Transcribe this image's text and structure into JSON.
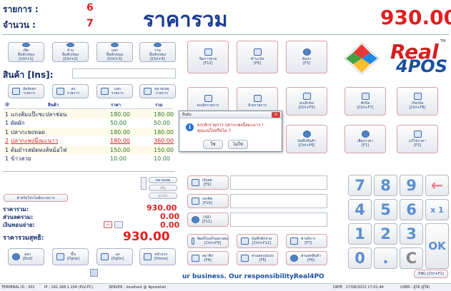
{
  "summary": {
    "items_label": "รายการ :",
    "items_value": "6",
    "qty_label": "จำนวน :",
    "qty_value": "7",
    "title": "ราคารวม",
    "total": "930.00"
  },
  "logo": {
    "real": "Real",
    "fourpos": "4POS",
    "tm": "TM"
  },
  "top_buttons": [
    {
      "label": "เปิด\nลิ้นชัก/ห่อง\n[Ctrl+1]"
    },
    {
      "label": "ย้าย\nลิ้นชัก/ห่อง\n[Ctrl+2]"
    },
    {
      "label": "แยก\nลิ้นชัก/ห่อง\n[Ctrl+3]"
    },
    {
      "label": "รวม\nลิ้นชัก/ห่อง\n[Ctrl+4]"
    }
  ],
  "product_label": "สินค้า [Ins]:",
  "edit_buttons": [
    {
      "label": "ลัดจัดส่ง\nรายการ"
    },
    {
      "label": "ลบ\nรายการ"
    },
    {
      "label": "แยก\nรายการ"
    },
    {
      "label": "หมายเหตุ\nรายการ"
    }
  ],
  "table": {
    "headers": [
      "@",
      "สินค้า",
      "ราคา",
      "รวม"
    ],
    "rows": [
      {
        "qty": "1",
        "name": "แกงส้มแป๊ะซะปลาช่อน",
        "price": "180.00",
        "total": "180.00",
        "style": "normal"
      },
      {
        "qty": "1",
        "name": "ผัดผัก",
        "price": "50.00",
        "total": "50.00",
        "style": "normal"
      },
      {
        "qty": "1",
        "name": "ปลากะพงทอด",
        "price": "180.00",
        "total": "180.00",
        "style": "normal"
      },
      {
        "qty": "2",
        "name": "ปลากะพงนึ่งมะนาว",
        "price": "180.00",
        "total": "360.00",
        "style": "red"
      },
      {
        "qty": "1",
        "name": "ต้มยำรสมัดหงส์หม้อไฟ",
        "price": "150.00",
        "total": "150.00",
        "style": "normal"
      },
      {
        "qty": "1",
        "name": "ข้าวสวย",
        "price": "10.00",
        "total": "10.00",
        "style": "normal"
      }
    ]
  },
  "side_small": {
    "note": "หมายเหตุ",
    "add": "เพิ่ม",
    "cancel": "ยกเลิก"
  },
  "promo_button": "สำหรับโปรโมชั่นรายการ",
  "totals": {
    "price_label": "ราคารวม:",
    "price": "930.00",
    "discount_label": "ส่วนลดรวม:",
    "discount": "0.00",
    "change_label": "เงินทอนจ่าย:",
    "change": "0.00",
    "net_label": "ราคารวมสุทธิ:",
    "net": "930.00"
  },
  "bottom_buttons": [
    {
      "label": "ออก\n[End]"
    },
    {
      "label": "ขึ้น\n[PgUp]"
    },
    {
      "label": "ลง\n[PgDn]"
    },
    {
      "label": "หน้าแรก\n[Home]"
    }
  ],
  "mid_buttons": [
    {
      "label": "ปิดการขาย\n[F12]"
    },
    {
      "label": "ชำระเงิน\n[F8]"
    },
    {
      "label": "ค้นหา\n[F3]"
    },
    {
      "label": "ยกเลิกรายการ"
    },
    {
      "label": "ย้ายรายการ"
    },
    {
      "label": "ยกเลิกบิล\n[Ctrl+F5]"
    },
    {
      "label": "พักบิล\n[Ctrl+F7]"
    },
    {
      "label": "เรียกบิล\n[Ctrl+F8]"
    },
    {
      "label": "บันทึกสินค้า\n[Ctrl+F6]"
    },
    {
      "label": "เลือกราคา\n[F1]"
    },
    {
      "label": "แก้ไขราคา\n[F2]"
    }
  ],
  "pay_buttons": [
    {
      "label": "เงินสด\n[F9]"
    },
    {
      "label": "เครดิต\n[F10]"
    },
    {
      "label": "USD\n[F11]"
    }
  ],
  "bottom_mid": [
    {
      "label": "พิมพ์ใบเสร็จอย่างย่อ\n[Ctrl+F9]"
    },
    {
      "label": "บันทึกพักจ่าย\n[Ctrl+F12]"
    },
    {
      "label": "ค่าบริการ\n[F7]"
    },
    {
      "label": "สมาชิก\n[F4]"
    },
    {
      "label": "ส่วนลดรูปแบบ\n[F5]"
    },
    {
      "label": "ส่วนลดสินค้า\n[F6]"
    }
  ],
  "numpad": [
    "7",
    "8",
    "9",
    "←",
    "4",
    "5",
    "6",
    "x 1",
    "1",
    "2",
    "3",
    "OK",
    "0",
    ".",
    "C"
  ],
  "dialog": {
    "title": "ยืนยัน",
    "message": "ยกเลิกรายการ ปลากะพงนึ่งมะนาว !\nคุณแน่ใจหรือไม่ ?",
    "yes": "ใช่",
    "no": "ไม่ใช่"
  },
  "marquee": "ur business. Our responsibility.",
  "brand": "Real4PO",
  "lang_button": "ENG [Ctrl+F1]",
  "status": {
    "terminal": "TERMINAL ID : 001",
    "ip": "IP : 192.168.1.104 (PLV-PC)",
    "server": "SERVER : localhost @ 4posretail",
    "date": "DATE : 17/08/2022 17:01:44",
    "user": "USER : ผู้ใช้ (ผู้ใช้)"
  }
}
